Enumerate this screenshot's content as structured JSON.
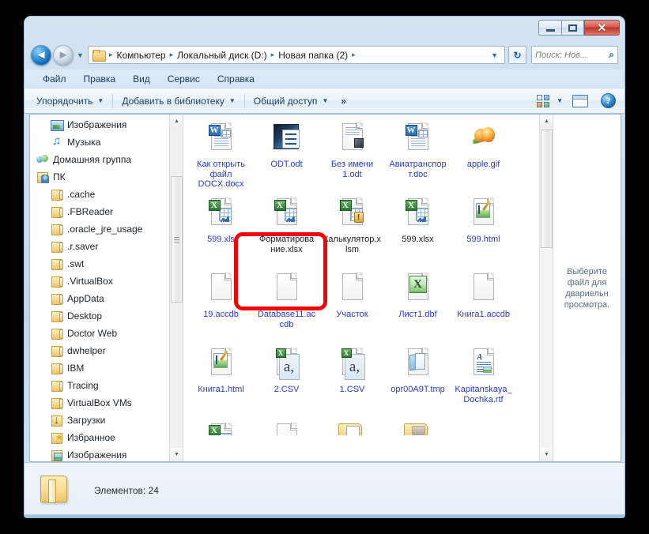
{
  "window": {
    "controls": {
      "minimize_label": "—",
      "maximize_label": "❐",
      "close_label": "✕"
    }
  },
  "navigation": {
    "back_label": "◄",
    "forward_label": "►",
    "history_label": "▼",
    "refresh_label": "↻",
    "address_dropdown_label": "▼",
    "breadcrumbs": [
      {
        "label": "Компьютер"
      },
      {
        "label": "Локальный диск (D:)"
      },
      {
        "label": "Новая папка (2)"
      }
    ],
    "breadcrumb_separator": "▸",
    "search": {
      "placeholder": "Поиск: Нов...",
      "icon": "search-icon"
    }
  },
  "menubar": {
    "items": [
      {
        "label": "Файл",
        "accel": "Ф"
      },
      {
        "label": "Правка",
        "accel": "П"
      },
      {
        "label": "Вид",
        "accel": "В"
      },
      {
        "label": "Сервис",
        "accel": "е"
      },
      {
        "label": "Справка",
        "accel": "С"
      }
    ]
  },
  "commandbar": {
    "organize_label": "Упорядочить",
    "add_to_library_label": "Добавить в библиотеку",
    "share_label": "Общий доступ",
    "overflow_label": "»",
    "caret": "▼",
    "views_caret": "▼",
    "views_icon": "views-icon",
    "preview_pane_icon": "preview-pane-icon",
    "help_label": "?"
  },
  "navpane": {
    "items": [
      {
        "label": "Изображения",
        "icon": "picture-icon",
        "level": 1
      },
      {
        "label": "Музыка",
        "icon": "music-icon",
        "level": 1
      },
      {
        "label": "Домашняя группа",
        "icon": "homegroup-icon",
        "level": 0
      },
      {
        "label": "ПК",
        "icon": "pc-icon",
        "level": 0
      },
      {
        "label": ".cache",
        "icon": "folder-icon",
        "level": 1
      },
      {
        "label": ".FBReader",
        "icon": "folder-icon",
        "level": 1
      },
      {
        "label": ".oracle_jre_usage",
        "icon": "folder-icon",
        "level": 1
      },
      {
        "label": ".r.saver",
        "icon": "folder-icon",
        "level": 1
      },
      {
        "label": ".swt",
        "icon": "folder-icon",
        "level": 1
      },
      {
        "label": ".VirtualBox",
        "icon": "folder-icon",
        "level": 1
      },
      {
        "label": "AppData",
        "icon": "folder-icon",
        "level": 1
      },
      {
        "label": "Desktop",
        "icon": "folder-icon",
        "level": 1
      },
      {
        "label": "Doctor Web",
        "icon": "folder-icon",
        "level": 1
      },
      {
        "label": "dwhelper",
        "icon": "folder-icon",
        "level": 1
      },
      {
        "label": "IBM",
        "icon": "folder-icon",
        "level": 1
      },
      {
        "label": "Tracing",
        "icon": "folder-icon",
        "level": 1
      },
      {
        "label": "VirtualBox VMs",
        "icon": "folder-icon",
        "level": 1
      },
      {
        "label": "Загрузки",
        "icon": "downloads-icon",
        "level": 1
      },
      {
        "label": "Избранное",
        "icon": "favorites-icon",
        "level": 1
      },
      {
        "label": "Изображения",
        "icon": "pictures-folder-icon",
        "level": 1
      }
    ],
    "scroll_up_label": "▲",
    "scroll_down_label": "▼"
  },
  "files": {
    "items": [
      {
        "name": "Как открыть файл DOCX.docx",
        "icon": "word-doc-icon",
        "selected": true,
        "label_color": "#2b3bd6"
      },
      {
        "name": "ODT.odt",
        "icon": "odt-writer-icon",
        "selected": false,
        "label_color": "#2b3bd6"
      },
      {
        "name": "Без имени 1.odt",
        "icon": "odt-plain-icon",
        "selected": false,
        "label_color": "#2b3bd6"
      },
      {
        "name": "Авиатранспорт.doc",
        "icon": "word-doc-icon",
        "selected": false,
        "label_color": "#2b3bd6"
      },
      {
        "name": "apple.gif",
        "icon": "image-gif-icon",
        "selected": false,
        "label_color": "#2b3bd6"
      },
      {
        "name": "599.xls",
        "icon": "excel-xls-icon",
        "selected": false,
        "label_color": "#2b3bd6"
      },
      {
        "name": "Форматирование.xlsx",
        "icon": "excel-xlsx-icon",
        "selected": false,
        "label_color": "#1c1c1c"
      },
      {
        "name": "Калькулятор.xlsm",
        "icon": "excel-xlsm-icon",
        "selected": false,
        "label_color": "#1c1c1c"
      },
      {
        "name": "599.xlsx",
        "icon": "excel-xlsx-icon",
        "selected": false,
        "label_color": "#1c1c1c"
      },
      {
        "name": "599.html",
        "icon": "html-icon",
        "selected": false,
        "label_color": "#2b3bd6"
      },
      {
        "name": "19.accdb",
        "icon": "blank-page-icon",
        "selected": false,
        "label_color": "#2b3bd6"
      },
      {
        "name": "Database11.accdb",
        "icon": "blank-page-icon",
        "selected": false,
        "label_color": "#2b3bd6"
      },
      {
        "name": "Участок",
        "icon": "blank-page-icon",
        "selected": false,
        "label_color": "#2b3bd6"
      },
      {
        "name": "Лист1.dbf",
        "icon": "excel-dbf-icon",
        "selected": false,
        "label_color": "#2b3bd6"
      },
      {
        "name": "Книга1.accdb",
        "icon": "blank-page-icon",
        "selected": false,
        "label_color": "#2b3bd6"
      },
      {
        "name": "Книга1.html",
        "icon": "html-icon",
        "selected": false,
        "label_color": "#2b3bd6"
      },
      {
        "name": "2.CSV",
        "icon": "csv-icon",
        "selected": false,
        "label_color": "#2b3bd6"
      },
      {
        "name": "1.CSV",
        "icon": "csv-icon",
        "selected": false,
        "label_color": "#2b3bd6"
      },
      {
        "name": "opr00A9T.tmp",
        "icon": "tmp-icon",
        "selected": false,
        "label_color": "#2b3bd6"
      },
      {
        "name": "Kapitanskaya_Dochka.rtf",
        "icon": "rtf-icon",
        "selected": false,
        "label_color": "#2b3bd6"
      },
      {
        "name": "",
        "icon": "excel-xls-icon",
        "selected": false,
        "label_color": "#2b3bd6"
      },
      {
        "name": "",
        "icon": "blank-page-icon",
        "selected": false,
        "label_color": "#2b3bd6"
      },
      {
        "name": "",
        "icon": "folder-doc-icon",
        "selected": false,
        "label_color": "#2b3bd6"
      },
      {
        "name": "",
        "icon": "folder-image-icon",
        "selected": false,
        "label_color": "#2b3bd6"
      }
    ],
    "csv_glyph": "a,",
    "excel_glyph": "X",
    "word_glyph": "W",
    "warn_glyph": "!",
    "rtf_glyph": "A"
  },
  "preview": {
    "text": "Выберите файл для двариельно просмотра.",
    "line1": "Выберите",
    "line2": "файл для",
    "line3": "двариельн",
    "line4": "просмотра."
  },
  "status": {
    "items_label": "Элементов: 24",
    "folder_icon": "folder-icon"
  },
  "annotation": {
    "color": "#f10404",
    "target": "Как открыть файл DOCX.docx"
  },
  "scrollbars": {
    "up_label": "▲",
    "down_label": "▼"
  }
}
